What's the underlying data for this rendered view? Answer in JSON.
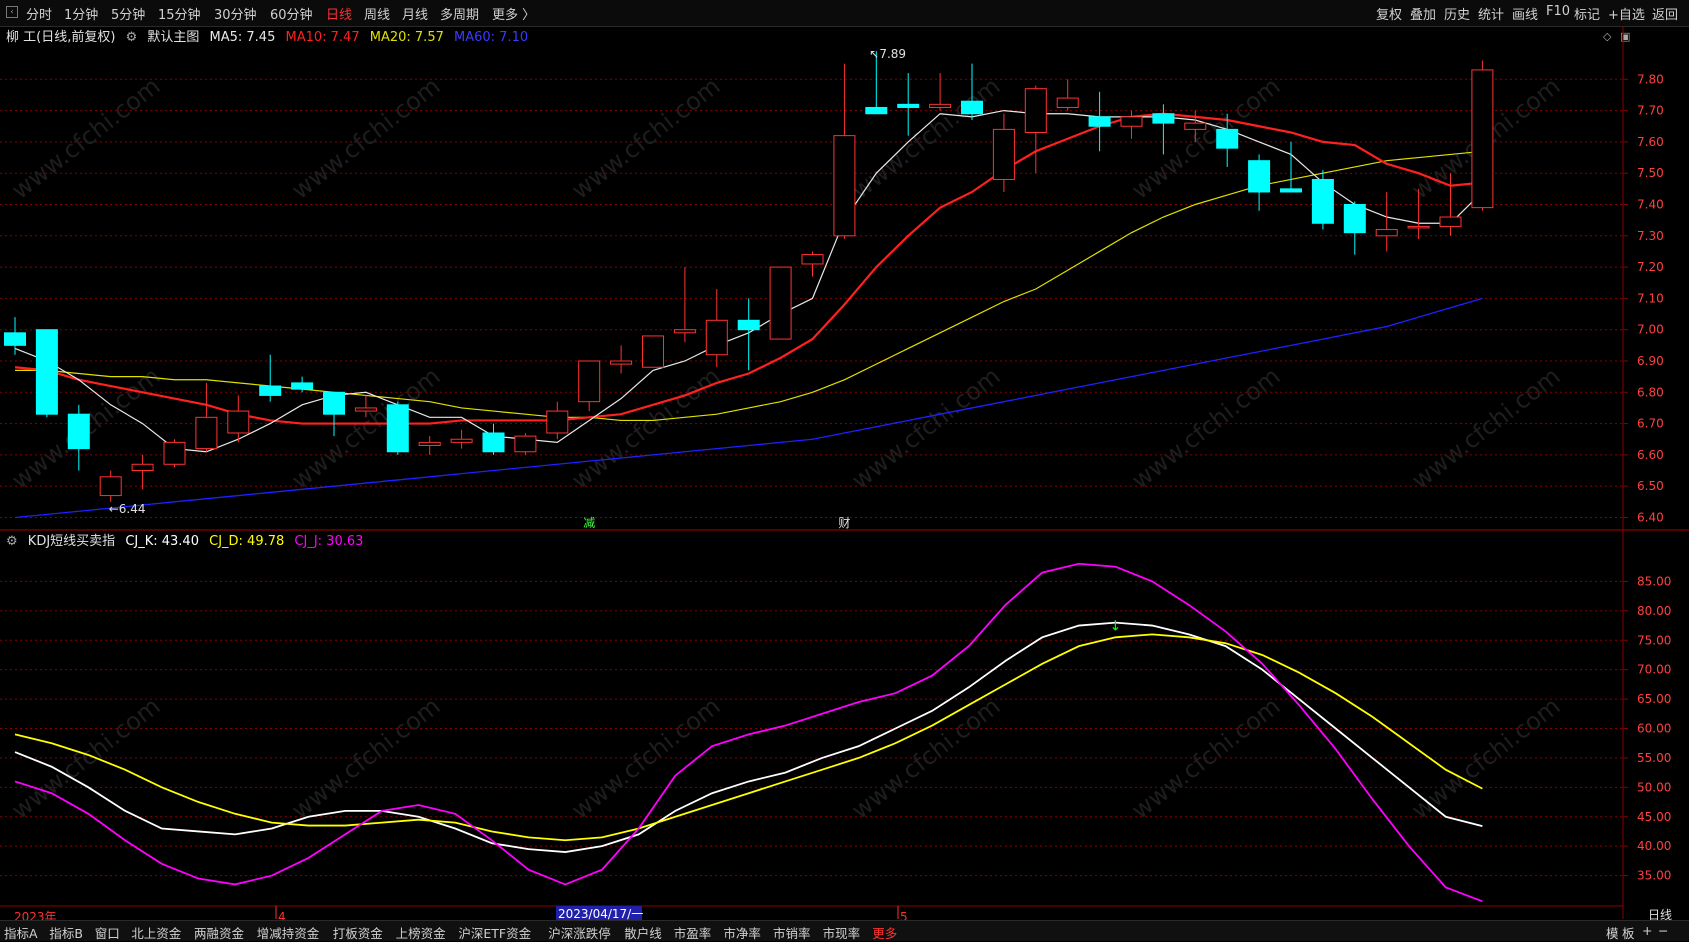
{
  "toolbar": {
    "left_items": [
      "分时",
      "1分钟",
      "5分钟",
      "15分钟",
      "30分钟",
      "60分钟",
      "日线",
      "周线",
      "月线",
      "多周期",
      "更多 〉"
    ],
    "active": "日线",
    "right_items": [
      "复权",
      "叠加",
      "历史",
      "统计",
      "画线",
      "F10",
      "标记",
      "+自选",
      "返回"
    ]
  },
  "main_title": {
    "stock": "柳 工(日线,前复权)",
    "template": "默认主图",
    "ma5": "MA5: 7.45",
    "ma10": "MA10: 7.47",
    "ma20": "MA20: 7.57",
    "ma60": "MA60: 7.10"
  },
  "kdj_title": {
    "name": "KDJ短线买卖指",
    "k": "CJ_K: 43.40",
    "d": "CJ_D: 49.78",
    "j": "CJ_J: 30.63"
  },
  "bottom_tabs": [
    "指标A",
    "指标B",
    "窗口",
    "北上资金",
    "两融资金",
    "增减持资金",
    "打板资金",
    "上榜资金",
    "沪深ETF资金",
    "沪深涨跌停",
    "散户线",
    "市盈率",
    "市净率",
    "市销率",
    "市现率",
    "更多"
  ],
  "bottom_right": [
    "模",
    "板",
    "+",
    "−"
  ],
  "corner_label": "日线",
  "date_labels": {
    "year": "2023年",
    "m4": "4",
    "cursor": "2023/04/17/一",
    "m5": "5"
  },
  "markers": {
    "jian": "减",
    "cai": "财"
  },
  "watermark": "www.cfchi.com",
  "colors": {
    "up": "#ff3232",
    "down": "#00ffff",
    "ma5": "#e8e8e8",
    "ma10": "#ff2020",
    "ma20": "#e0e000",
    "ma60": "#2020ff",
    "k": "#ffffff",
    "d": "#ffff00",
    "j": "#ff00ff",
    "grid": "#8a0000"
  },
  "chart_data": [
    {
      "type": "candlestick",
      "ylim": [
        6.36,
        7.9
      ],
      "y_ticks": [
        "7.80",
        "7.70",
        "7.60",
        "7.50",
        "7.40",
        "7.30",
        "7.20",
        "7.10",
        "7.00",
        "6.90",
        "6.80",
        "6.70",
        "6.60",
        "6.50",
        "6.40"
      ],
      "annotations": {
        "high": "7.89",
        "low": "6.44"
      },
      "ohlc": [
        [
          6.99,
          7.04,
          6.92,
          6.95
        ],
        [
          7.0,
          7.0,
          6.72,
          6.73
        ],
        [
          6.73,
          6.76,
          6.55,
          6.62
        ],
        [
          6.47,
          6.55,
          6.45,
          6.53
        ],
        [
          6.55,
          6.6,
          6.49,
          6.57
        ],
        [
          6.57,
          6.65,
          6.56,
          6.64
        ],
        [
          6.62,
          6.83,
          6.61,
          6.72
        ],
        [
          6.67,
          6.79,
          6.64,
          6.74
        ],
        [
          6.82,
          6.92,
          6.77,
          6.79
        ],
        [
          6.83,
          6.85,
          6.8,
          6.81
        ],
        [
          6.8,
          6.8,
          6.66,
          6.73
        ],
        [
          6.74,
          6.79,
          6.72,
          6.75
        ],
        [
          6.76,
          6.77,
          6.6,
          6.61
        ],
        [
          6.63,
          6.66,
          6.6,
          6.64
        ],
        [
          6.64,
          6.68,
          6.62,
          6.65
        ],
        [
          6.67,
          6.7,
          6.6,
          6.61
        ],
        [
          6.61,
          6.67,
          6.6,
          6.66
        ],
        [
          6.67,
          6.77,
          6.65,
          6.74
        ],
        [
          6.77,
          6.89,
          6.74,
          6.9
        ],
        [
          6.89,
          6.95,
          6.86,
          6.9
        ],
        [
          6.88,
          6.97,
          6.88,
          6.98
        ],
        [
          6.99,
          7.2,
          6.96,
          7.0
        ],
        [
          6.92,
          7.13,
          6.88,
          7.03
        ],
        [
          7.03,
          7.1,
          6.87,
          7.0
        ],
        [
          6.97,
          7.2,
          6.97,
          7.2
        ],
        [
          7.21,
          7.25,
          7.17,
          7.24
        ],
        [
          7.3,
          7.85,
          7.29,
          7.62
        ],
        [
          7.71,
          7.89,
          7.71,
          7.69
        ],
        [
          7.72,
          7.82,
          7.62,
          7.71
        ],
        [
          7.71,
          7.82,
          7.7,
          7.72
        ],
        [
          7.73,
          7.85,
          7.67,
          7.69
        ],
        [
          7.48,
          7.69,
          7.44,
          7.64
        ],
        [
          7.63,
          7.78,
          7.5,
          7.77
        ],
        [
          7.71,
          7.8,
          7.7,
          7.74
        ],
        [
          7.68,
          7.76,
          7.57,
          7.65
        ],
        [
          7.65,
          7.7,
          7.61,
          7.68
        ],
        [
          7.69,
          7.72,
          7.56,
          7.66
        ],
        [
          7.64,
          7.7,
          7.6,
          7.66
        ],
        [
          7.64,
          7.69,
          7.52,
          7.58
        ],
        [
          7.54,
          7.56,
          7.38,
          7.44
        ],
        [
          7.45,
          7.6,
          7.44,
          7.44
        ],
        [
          7.48,
          7.51,
          7.32,
          7.34
        ],
        [
          7.4,
          7.41,
          7.24,
          7.31
        ],
        [
          7.3,
          7.44,
          7.25,
          7.32
        ],
        [
          7.33,
          7.45,
          7.29,
          7.33
        ],
        [
          7.33,
          7.5,
          7.3,
          7.36
        ],
        [
          7.39,
          7.86,
          7.38,
          7.83
        ]
      ],
      "ma5": [
        6.94,
        6.9,
        6.84,
        6.76,
        6.7,
        6.62,
        6.61,
        6.65,
        6.7,
        6.76,
        6.79,
        6.8,
        6.76,
        6.72,
        6.72,
        6.66,
        6.65,
        6.64,
        6.71,
        6.78,
        6.87,
        6.9,
        6.95,
        6.99,
        7.05,
        7.1,
        7.35,
        7.5,
        7.6,
        7.69,
        7.68,
        7.7,
        7.69,
        7.69,
        7.68,
        7.68,
        7.68,
        7.67,
        7.64,
        7.6,
        7.56,
        7.47,
        7.4,
        7.36,
        7.34,
        7.34,
        7.44
      ],
      "ma10": [
        6.88,
        6.87,
        6.84,
        6.82,
        6.8,
        6.78,
        6.76,
        6.73,
        6.71,
        6.7,
        6.7,
        6.7,
        6.7,
        6.7,
        6.71,
        6.71,
        6.71,
        6.71,
        6.72,
        6.73,
        6.76,
        6.79,
        6.83,
        6.86,
        6.91,
        6.97,
        7.08,
        7.2,
        7.3,
        7.39,
        7.44,
        7.51,
        7.57,
        7.61,
        7.65,
        7.68,
        7.69,
        7.68,
        7.67,
        7.65,
        7.63,
        7.6,
        7.59,
        7.53,
        7.5,
        7.46,
        7.47
      ],
      "ma20": [
        6.87,
        6.87,
        6.86,
        6.85,
        6.85,
        6.84,
        6.84,
        6.83,
        6.82,
        6.81,
        6.8,
        6.79,
        6.78,
        6.77,
        6.75,
        6.74,
        6.73,
        6.72,
        6.72,
        6.71,
        6.71,
        6.72,
        6.73,
        6.75,
        6.77,
        6.8,
        6.84,
        6.89,
        6.94,
        6.99,
        7.04,
        7.09,
        7.13,
        7.19,
        7.25,
        7.31,
        7.36,
        7.4,
        7.43,
        7.46,
        7.48,
        7.5,
        7.52,
        7.54,
        7.55,
        7.56,
        7.57
      ],
      "ma60": [
        6.4,
        6.41,
        6.42,
        6.43,
        6.44,
        6.45,
        6.46,
        6.47,
        6.48,
        6.49,
        6.5,
        6.51,
        6.52,
        6.53,
        6.54,
        6.55,
        6.56,
        6.57,
        6.58,
        6.59,
        6.6,
        6.61,
        6.62,
        6.63,
        6.64,
        6.65,
        6.67,
        6.69,
        6.71,
        6.73,
        6.75,
        6.77,
        6.79,
        6.81,
        6.83,
        6.85,
        6.87,
        6.89,
        6.91,
        6.93,
        6.95,
        6.97,
        6.99,
        7.01,
        7.04,
        7.07,
        7.1
      ]
    },
    {
      "type": "line",
      "ylim": [
        30,
        90
      ],
      "y_ticks": [
        "85.00",
        "80.00",
        "75.00",
        "70.00",
        "65.00",
        "60.00",
        "55.00",
        "50.00",
        "45.00",
        "40.00",
        "35.00"
      ],
      "series": [
        {
          "name": "CJ_K",
          "values": [
            56,
            53.5,
            50,
            46,
            43,
            42.5,
            42,
            43,
            45,
            46,
            46,
            45,
            43,
            40.5,
            39.5,
            39,
            40,
            42,
            46,
            49,
            51,
            52.5,
            55,
            57,
            60,
            63,
            67,
            71.5,
            75.5,
            77.5,
            78,
            77.5,
            76,
            74,
            70,
            65,
            60,
            55,
            50,
            45,
            43.4
          ]
        },
        {
          "name": "CJ_D",
          "values": [
            59,
            57.5,
            55.5,
            53,
            50,
            47.5,
            45.5,
            44,
            43.5,
            43.5,
            44,
            44.5,
            44,
            42.5,
            41.5,
            41,
            41.5,
            43,
            45,
            47,
            49,
            51,
            53,
            55,
            57.5,
            60.5,
            64,
            67.5,
            71,
            74,
            75.5,
            76,
            75.5,
            74.5,
            72.5,
            69.5,
            66,
            62,
            57.5,
            53,
            49.78
          ]
        },
        {
          "name": "CJ_J",
          "values": [
            51,
            49,
            45.5,
            41,
            37,
            34.5,
            33.5,
            35,
            38,
            42,
            46,
            47,
            45.5,
            41,
            36,
            33.5,
            36,
            43,
            52,
            57,
            59,
            60.5,
            62.5,
            64.5,
            66,
            69,
            74,
            81,
            86.5,
            88,
            87.5,
            85,
            81,
            76.5,
            71,
            64,
            56.5,
            48,
            40,
            33,
            30.63
          ]
        }
      ]
    }
  ]
}
